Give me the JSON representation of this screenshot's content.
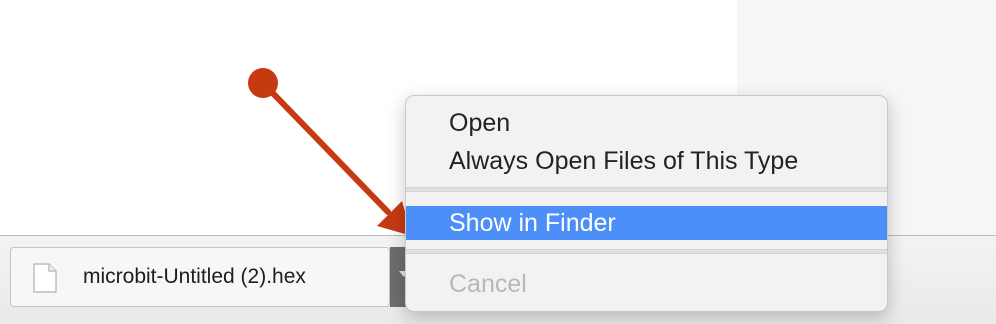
{
  "download": {
    "file_name": "microbit-Untitled (2).hex",
    "file_icon": "document-icon",
    "toggle_icon": "chevron-down-icon"
  },
  "context_menu": {
    "items": [
      {
        "label": "Open",
        "state": "normal"
      },
      {
        "label": "Always Open Files of This Type",
        "state": "normal"
      },
      {
        "label": "Show in Finder",
        "state": "selected"
      },
      {
        "label": "Cancel",
        "state": "disabled"
      }
    ],
    "highlight_color": "#4d8ff8"
  },
  "annotation": {
    "type": "arrow",
    "color": "#c53a11",
    "points_to": "Show in Finder"
  }
}
